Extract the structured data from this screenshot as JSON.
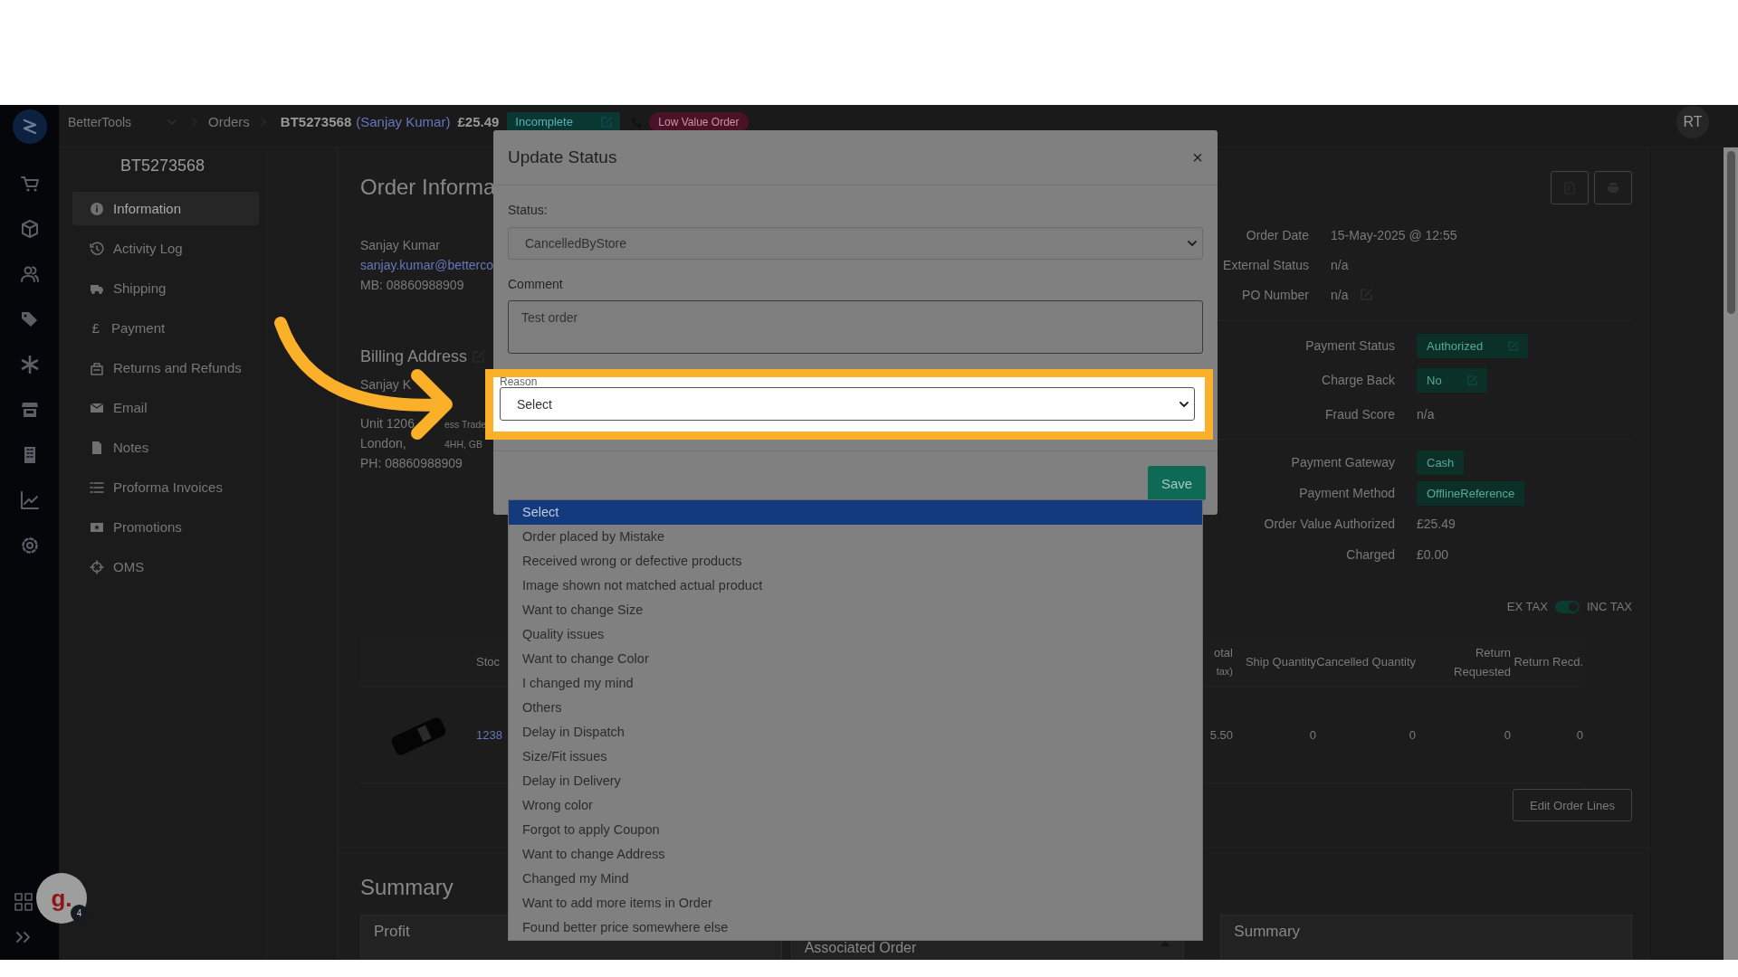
{
  "top_bar": {
    "company": "BetterTools",
    "breadcrumb": "Orders",
    "order_number": "BT5273568",
    "customer": "(Sanjay Kumar)",
    "total": "£25.49",
    "status_badge": "Incomplete",
    "tag": "Low Value Order",
    "avatar": "RT"
  },
  "order_nav": {
    "title": "BT5273568",
    "items": [
      {
        "label": "Information",
        "selected": true
      },
      {
        "label": "Activity Log",
        "selected": false
      },
      {
        "label": "Shipping",
        "selected": false
      },
      {
        "label": "Payment",
        "selected": false,
        "glyph": "£"
      },
      {
        "label": "Returns and Refunds",
        "selected": false
      },
      {
        "label": "Email",
        "selected": false
      },
      {
        "label": "Notes",
        "selected": false
      },
      {
        "label": "Proforma Invoices",
        "selected": false
      },
      {
        "label": "Promotions",
        "selected": false
      },
      {
        "label": "OMS",
        "selected": false
      }
    ]
  },
  "order_info": {
    "title": "Order Informa",
    "customer": {
      "name": "Sanjay Kumar",
      "email": "sanjay.kumar@betterco",
      "mobile_label": "MB:",
      "mobile": "08860988909"
    },
    "billing": {
      "title": "Billing Address",
      "name": "Sanjay K",
      "lines": [
        [
          "Unit 1206",
          "ess Trade"
        ],
        [
          "London,",
          "4HH, GB"
        ]
      ],
      "phone_label": "PH:",
      "phone": "08860988909"
    },
    "details": [
      {
        "label": "Order Date",
        "value": "15-May-2025 @ 12:55",
        "editable": false
      },
      {
        "label": "External Status",
        "value": "n/a",
        "editable": false
      },
      {
        "label": "PO Number",
        "value": "n/a",
        "editable": true
      }
    ],
    "payment": [
      {
        "label": "Payment Status",
        "value": "Authorized",
        "kind": "badge",
        "editable": true
      },
      {
        "label": "Charge Back",
        "value": "No",
        "kind": "badge",
        "editable": true
      },
      {
        "label": "Fraud Score",
        "value": "n/a",
        "kind": "text",
        "editable": false
      }
    ],
    "gateway": [
      {
        "label": "Payment Gateway",
        "value": "Cash",
        "kind": "badge"
      },
      {
        "label": "Payment Method",
        "value": "OfflineReference",
        "kind": "badge"
      },
      {
        "label": "Order Value Authorized",
        "value": "£25.49",
        "kind": "text"
      },
      {
        "label": "Charged",
        "value": "£0.00",
        "kind": "text"
      }
    ]
  },
  "order_lines": {
    "tax_toggle": {
      "off_label": "EX TAX",
      "on_label": "INC TAX",
      "on": true
    },
    "columns": [
      {
        "label": "Stoc"
      },
      {
        "label": "otal",
        "sub": "tax)"
      },
      {
        "label": "Ship Quantity"
      },
      {
        "label": "Cancelled Quantity"
      },
      {
        "label": "Return Requested"
      },
      {
        "label": "Return Recd."
      }
    ],
    "rows": [
      {
        "cells": [
          "1238",
          "5.50",
          "0",
          "0",
          "0",
          "0"
        ]
      }
    ],
    "edit_button": "Edit Order Lines"
  },
  "summary": {
    "title": "Summary",
    "cards": [
      {
        "title": "Profit",
        "collapsible": false
      },
      {
        "title": "Associated Order",
        "collapsible": true
      },
      {
        "title": "Summary",
        "collapsible": false
      }
    ]
  },
  "modal": {
    "title": "Update Status",
    "close": "×",
    "fields": [
      {
        "label": "Status:",
        "kind": "select",
        "value": "CancelledByStore",
        "highlighted": false
      },
      {
        "label": "Comment",
        "kind": "textarea",
        "value": "Test order",
        "highlighted": false
      },
      {
        "label": "Reason",
        "kind": "select",
        "value": "Select",
        "highlighted": true
      }
    ],
    "save": "Save",
    "options": [
      {
        "label": "Select",
        "selected": true
      },
      {
        "label": "Order placed by Mistake",
        "selected": false
      },
      {
        "label": "Received wrong or defective products",
        "selected": false
      },
      {
        "label": "Image shown not matched actual product",
        "selected": false
      },
      {
        "label": "Want to change Size",
        "selected": false
      },
      {
        "label": "Quality issues",
        "selected": false
      },
      {
        "label": "Want to change Color",
        "selected": false
      },
      {
        "label": "I changed my mind",
        "selected": false
      },
      {
        "label": "Others",
        "selected": false
      },
      {
        "label": "Delay in Dispatch",
        "selected": false
      },
      {
        "label": "Size/Fit issues",
        "selected": false
      },
      {
        "label": "Delay in Delivery",
        "selected": false
      },
      {
        "label": "Wrong color",
        "selected": false
      },
      {
        "label": "Forgot to apply Coupon",
        "selected": false
      },
      {
        "label": "Want to change Address",
        "selected": false
      },
      {
        "label": "Changed my Mind",
        "selected": false
      },
      {
        "label": "Want to add more items in Order",
        "selected": false
      },
      {
        "label": "Found better price somewhere else",
        "selected": false
      }
    ]
  },
  "guide_bubble": {
    "logo": "g.",
    "count": "4"
  }
}
